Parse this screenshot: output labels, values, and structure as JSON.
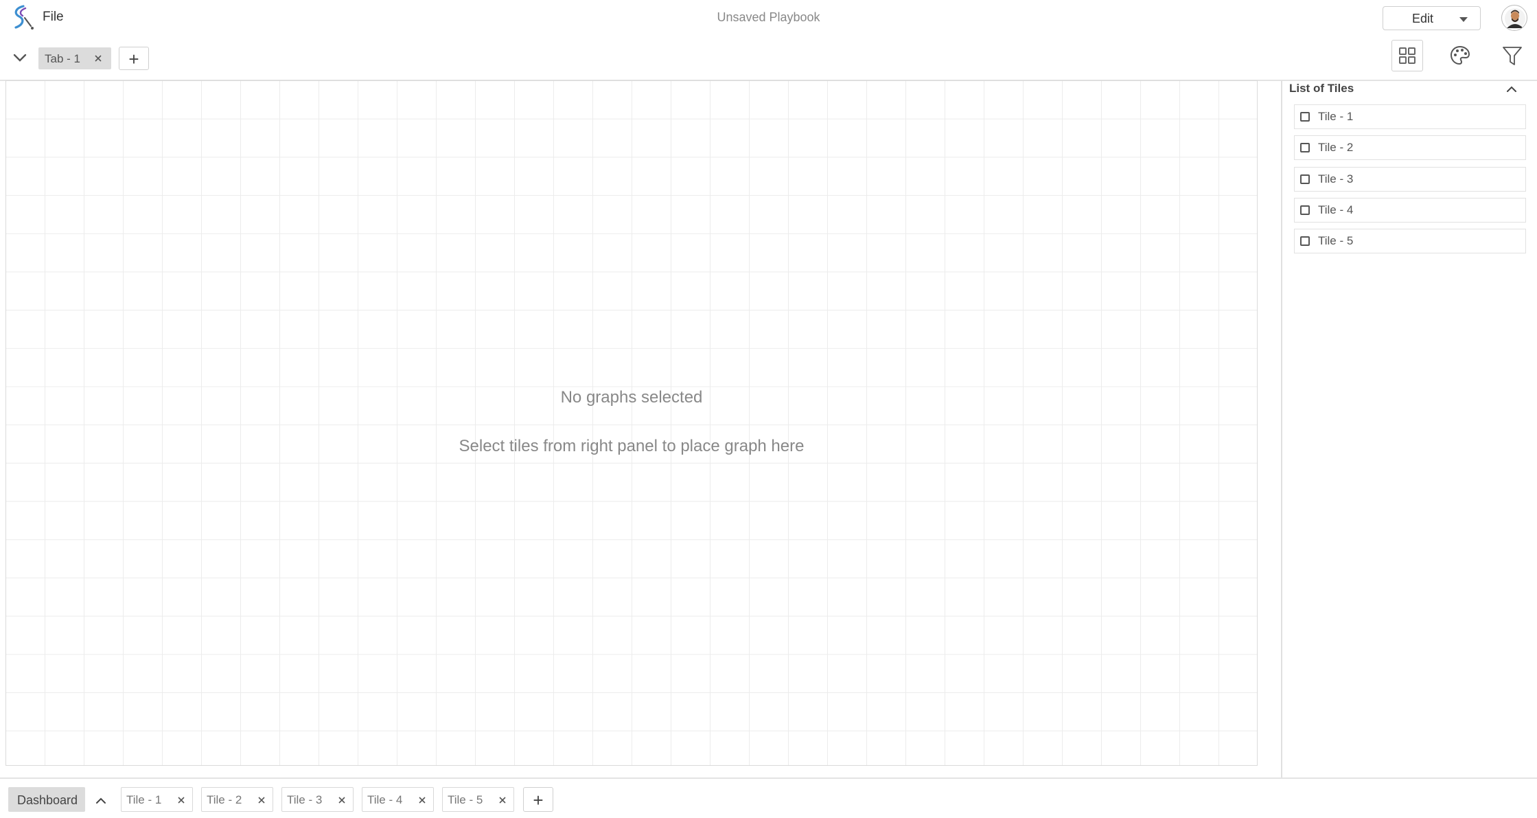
{
  "header": {
    "file_label": "File",
    "title": "Unsaved Playbook",
    "mode_label": "Edit",
    "logo_icon": "app-logo",
    "avatar_icon": "user-avatar",
    "brand_colors": [
      "#3d8fd1",
      "#7b4bb5"
    ]
  },
  "tabs": {
    "items": [
      {
        "label": "Tab - 1"
      }
    ],
    "add_label": "+"
  },
  "toolbar": {
    "icons": [
      "layout-grid-icon",
      "palette-icon",
      "filter-icon"
    ]
  },
  "canvas": {
    "empty_title": "No graphs selected",
    "empty_subtitle": "Select tiles from right panel to place graph here"
  },
  "tiles_panel": {
    "title": "List of Tiles",
    "items": [
      {
        "label": "Tile - 1",
        "checked": false
      },
      {
        "label": "Tile - 2",
        "checked": false
      },
      {
        "label": "Tile - 3",
        "checked": false
      },
      {
        "label": "Tile - 4",
        "checked": false
      },
      {
        "label": "Tile - 5",
        "checked": false
      }
    ]
  },
  "bottom_bar": {
    "dashboard_label": "Dashboard",
    "tiles": [
      {
        "label": "Tile - 1"
      },
      {
        "label": "Tile - 2"
      },
      {
        "label": "Tile - 3"
      },
      {
        "label": "Tile - 4"
      },
      {
        "label": "Tile - 5"
      }
    ],
    "add_label": "+"
  }
}
